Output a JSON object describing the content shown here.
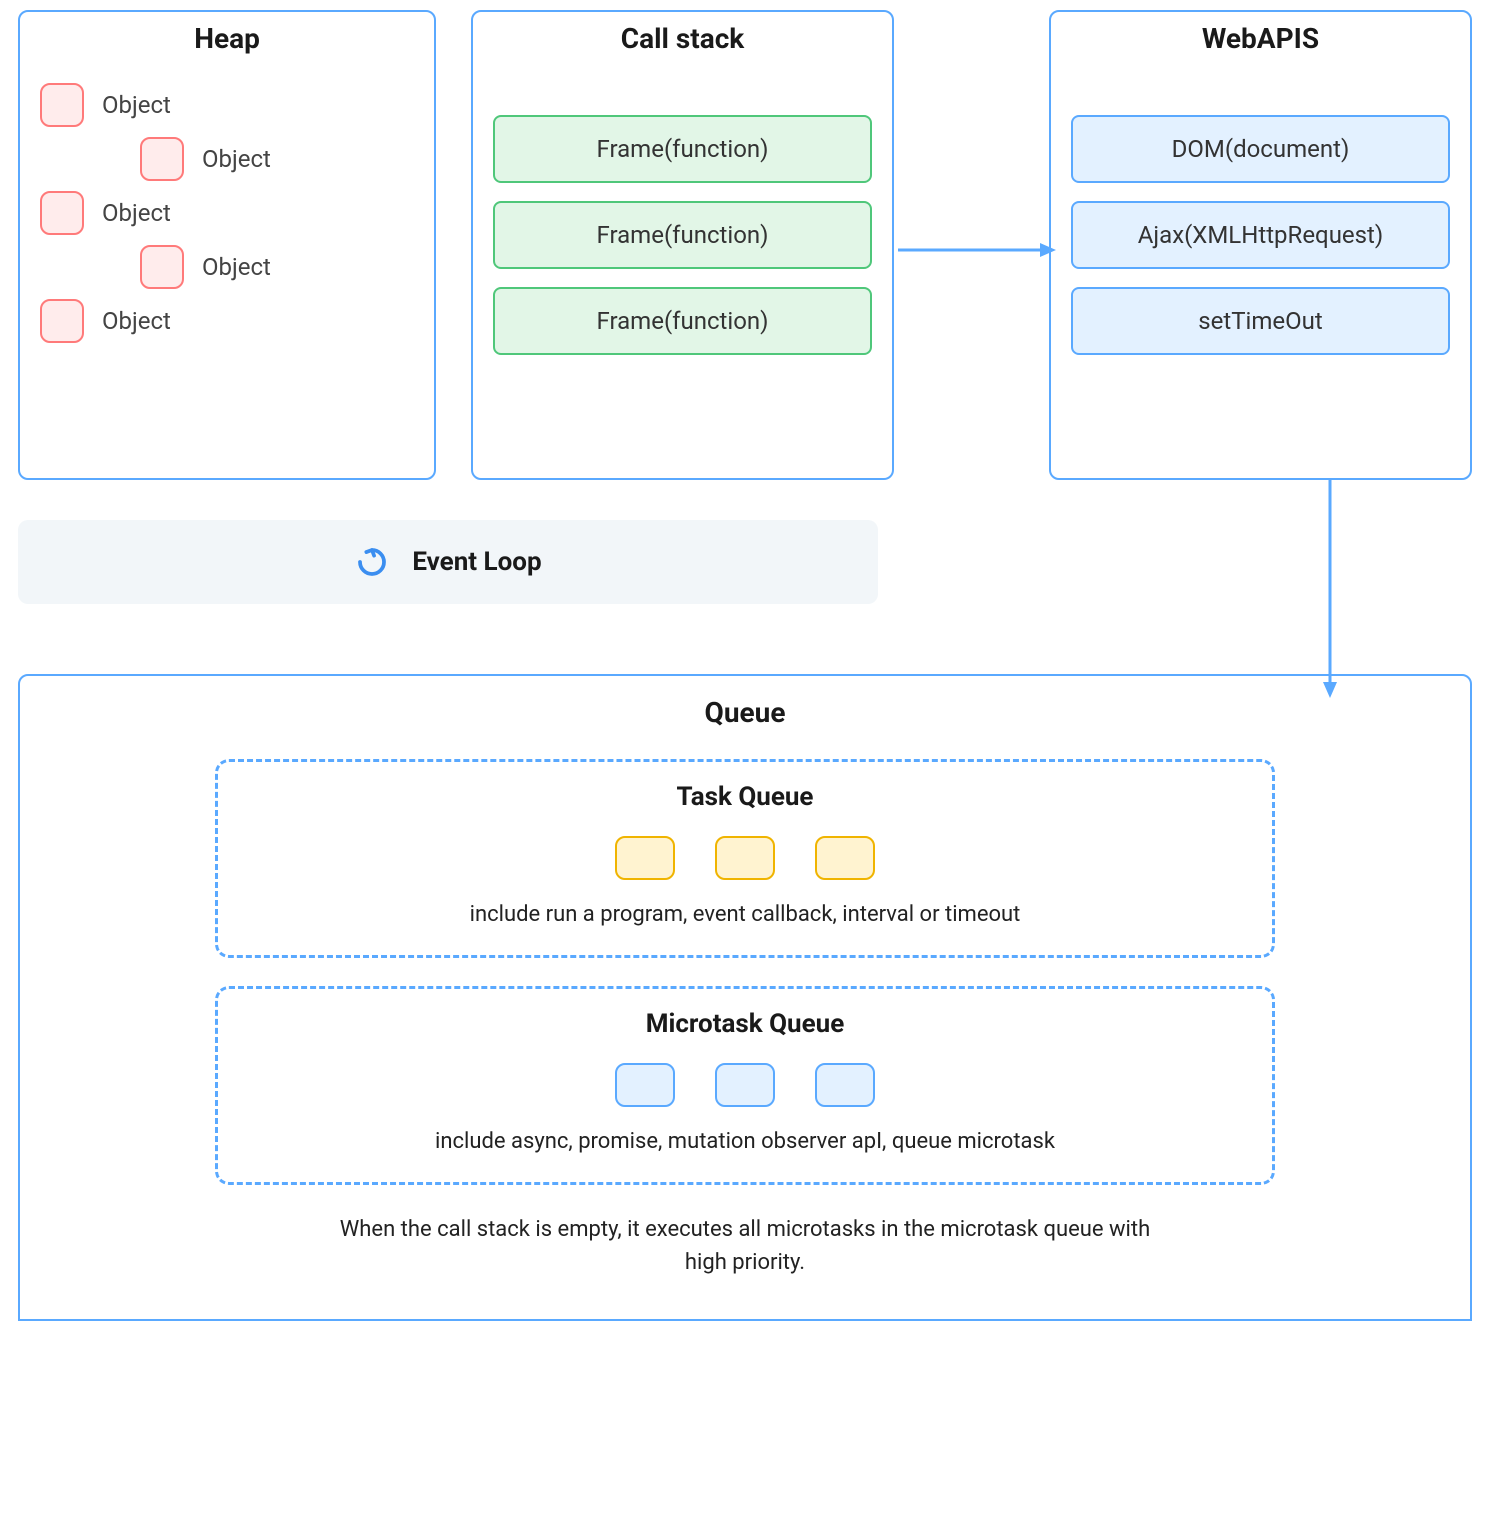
{
  "heap": {
    "title": "Heap",
    "items": [
      "Object",
      "Object",
      "Object",
      "Object",
      "Object"
    ]
  },
  "callstack": {
    "title": "Call stack",
    "frames": [
      "Frame(function)",
      "Frame(function)",
      "Frame(function)"
    ]
  },
  "webapis": {
    "title": "WebAPIS",
    "apis": [
      "DOM(document)",
      "Ajax(XMLHttpRequest)",
      "setTimeOut"
    ]
  },
  "event_loop": {
    "label": "Event Loop"
  },
  "queue": {
    "title": "Queue",
    "task_queue": {
      "title": "Task Queue",
      "desc": "include run a program, event callback, interval or timeout",
      "token_count": 3
    },
    "microtask_queue": {
      "title": "Microtask Queue",
      "desc": "include async, promise, mutation observer apI, queue microtask",
      "token_count": 3
    },
    "footer": "When the call stack is empty, it executes all microtasks in the microtask queue with high priority."
  },
  "colors": {
    "border_blue": "#5aa9ff",
    "heap_border": "#ff7a7a",
    "heap_fill": "#ffecec",
    "frame_border": "#4fc77a",
    "frame_fill": "#e2f6e7",
    "api_fill": "#e3f1ff",
    "task_border": "#f0b400",
    "task_fill": "#fff3d0"
  }
}
